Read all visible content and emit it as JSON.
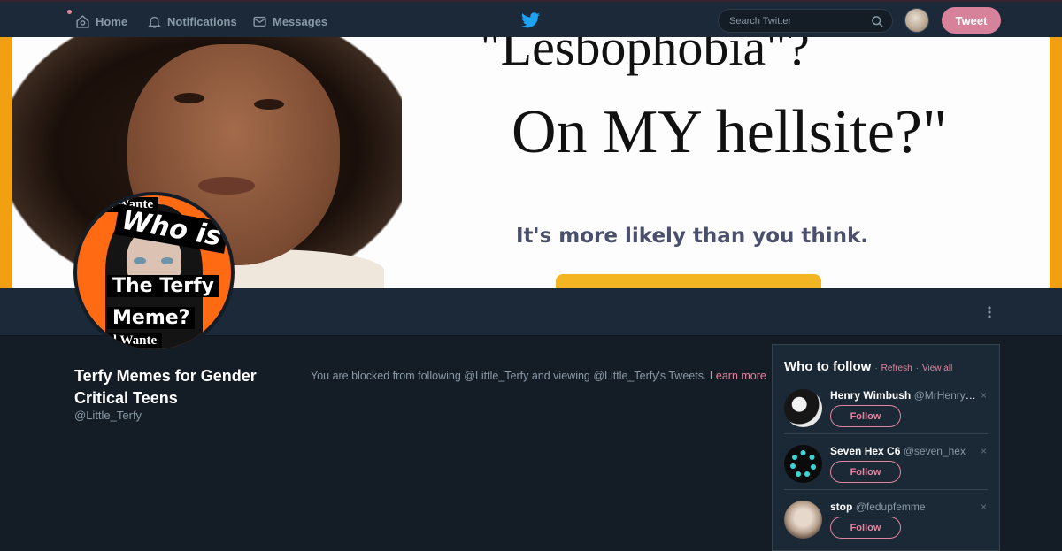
{
  "nav": {
    "home_label": "Home",
    "notifications_label": "Notifications",
    "messages_label": "Messages",
    "search_placeholder": "Search Twitter",
    "tweet_label": "Tweet",
    "accent": "#d7829b"
  },
  "banner": {
    "line1": "\"Lesbophobia\"?",
    "line2": "On MY hellsite?\"",
    "line3": "It's more likely than you think."
  },
  "avatar": {
    "wanted_top": "ed Wante",
    "who_is": "Who is",
    "the_terfy": "The Terfy",
    "meme": "Meme?",
    "wanted_bottom": "ed Wante"
  },
  "profile": {
    "name": "Terfy Memes for Gender Critical Teens",
    "handle": "@Little_Terfy",
    "blocked_text": "You are blocked from following @Little_Terfy and viewing @Little_Terfy's Tweets.",
    "learn_more": "Learn more"
  },
  "who_to_follow": {
    "title": "Who to follow",
    "refresh": "Refresh",
    "separator": "·",
    "view_all": "View all",
    "users": [
      {
        "name": "Henry Wimbush",
        "handle": "@MrHenryWimbush",
        "follow_label": "Follow",
        "close": "×"
      },
      {
        "name": "Seven Hex C6",
        "handle": "@seven_hex",
        "follow_label": "Follow",
        "close": "×"
      },
      {
        "name": "stop",
        "handle": "@fedupfemme",
        "follow_label": "Follow",
        "close": "×"
      }
    ]
  }
}
